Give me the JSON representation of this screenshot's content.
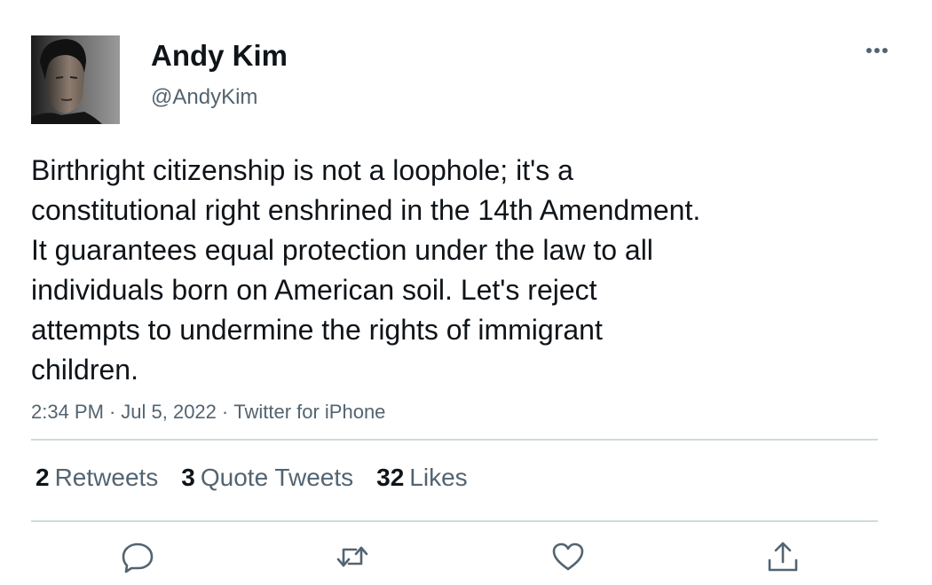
{
  "author": {
    "display_name": "Andy Kim",
    "handle": "@AndyKim",
    "avatar_icon": "profile-photo"
  },
  "tweet": {
    "text": "Birthright citizenship is not a loophole; it's a\nconstitutional right enshrined in the 14th Amendment.\nIt guarantees equal protection under the law to all\nindividuals born on American soil. Let's reject\nattempts to undermine the rights of immigrant\nchildren.",
    "time": "2:34 PM",
    "date": "Jul 5, 2022",
    "source": "Twitter for iPhone",
    "separator": "·"
  },
  "stats": {
    "retweets": {
      "count": "2",
      "label": "Retweets"
    },
    "quote_tweets": {
      "count": "3",
      "label": "Quote Tweets"
    },
    "likes": {
      "count": "32",
      "label": "Likes"
    }
  },
  "actions": {
    "reply_icon": "reply-icon",
    "retweet_icon": "retweet-icon",
    "like_icon": "heart-icon",
    "share_icon": "share-icon",
    "more_icon": "more-horizontal-icon"
  },
  "colors": {
    "text_primary": "#0f1419",
    "text_secondary": "#536471",
    "divider": "#cfd9de",
    "icon": "#536471"
  }
}
